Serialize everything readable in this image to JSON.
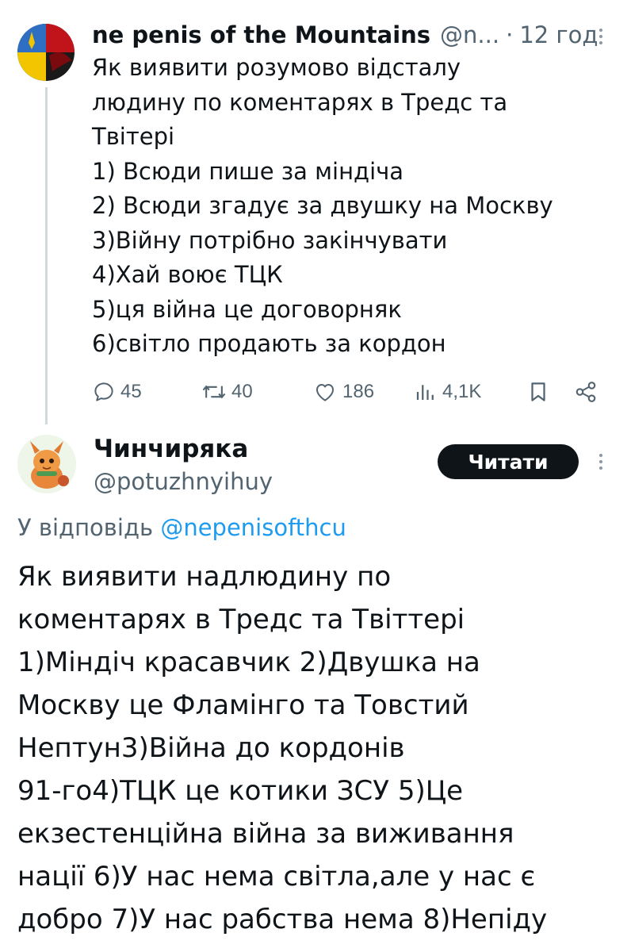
{
  "tweet1": {
    "author_name": "ne penis of the Mountains",
    "author_handle": "@n...",
    "separator": "·",
    "time": "12 год",
    "lines": [
      "Як виявити розумово відсталу",
      "людину по коментарях в Тредс та",
      "Твітері",
      "1) Всюди пише за міндіча",
      "2) Всюди згадує за двушку на Москву",
      "3)Війну потрібно закінчувати",
      "4)Хай воює ТЦК",
      "5)ця війна це договорняк",
      "6)світло продають за кордон"
    ],
    "stats": {
      "replies": "45",
      "reposts": "40",
      "likes": "186",
      "views": "4,1K"
    }
  },
  "tweet2": {
    "author_name": "Чинчиряка",
    "author_handle": "@potuzhnyihuy",
    "read_button": "Читати",
    "reply_prefix": "У відповідь",
    "reply_mention": "@nepenisofthcu",
    "lines": [
      "Як виявити надлюдину по",
      "коментарях в Тредс та Твіттері",
      "1)Міндіч красавчик 2)Двушка на",
      "Москву це Фламінго та Товстий",
      "Нептун3)Війна до кордонів",
      "91-го4)ТЦК це котики ЗСУ 5)Це",
      "екзестенційна війна за виживання",
      "нації 6)У нас нема світла,але у нас є",
      "добро 7)У нас рабства нема 8)Непіду"
    ]
  },
  "icons": {
    "reply": "speech-bubble-icon",
    "repost": "repost-arrows-icon",
    "like": "heart-icon",
    "views": "bar-chart-icon",
    "bookmark": "bookmark-icon",
    "share": "share-icon",
    "more": "vertical-dots-icon"
  },
  "colors": {
    "text": "#0f1419",
    "secondary": "#536471",
    "link": "#1d9bf0",
    "button_bg": "#0f1419"
  }
}
